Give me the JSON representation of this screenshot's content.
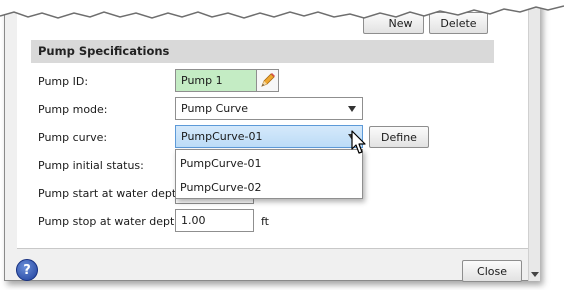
{
  "toolbar": {
    "new_label": "New",
    "delete_label": "Delete"
  },
  "section": {
    "title": "Pump Specifications"
  },
  "fields": {
    "pump_id": {
      "label": "Pump ID:",
      "value": "Pump 1"
    },
    "pump_mode": {
      "label": "Pump mode:",
      "value": "Pump Curve"
    },
    "pump_curve": {
      "label": "Pump curve:",
      "value": "PumpCurve-01",
      "define_label": "Define"
    },
    "initial_status": {
      "label": "Pump initial status:"
    },
    "start_depth": {
      "label": "Pump start at water depth:"
    },
    "stop_depth": {
      "label": "Pump stop at water depth:",
      "value": "1.00",
      "unit": "ft"
    }
  },
  "dropdown_options": [
    "PumpCurve-01",
    "PumpCurve-02"
  ],
  "footer": {
    "close_label": "Close",
    "help_symbol": "?"
  },
  "icons": {
    "edit": "pencil-icon",
    "help": "help-icon",
    "cursor": "mouse-cursor-icon"
  },
  "colors": {
    "green_field": "#c4ecc4",
    "selected_field": "#bcdcf7",
    "section_header": "#d9d9d9",
    "help": "#1e3f9c"
  }
}
